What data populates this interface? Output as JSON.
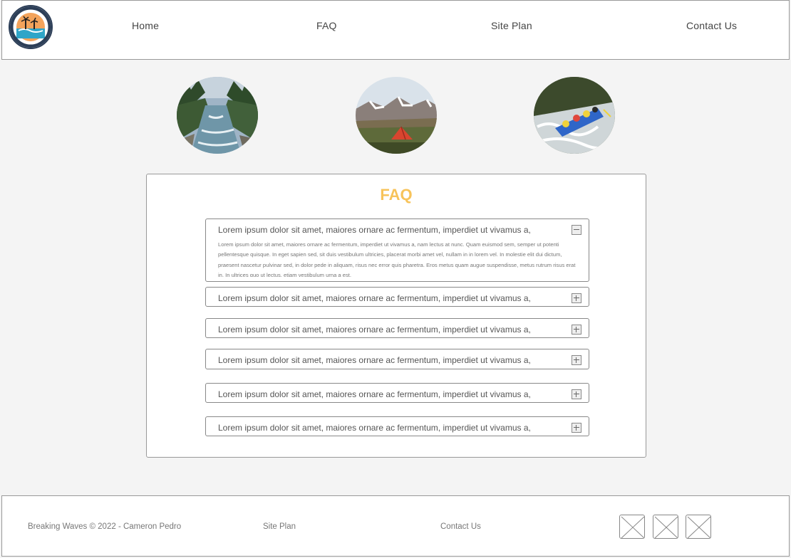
{
  "header": {
    "logo_alt": "Breaking Waves White Water Rafting",
    "nav": [
      {
        "label": "Home"
      },
      {
        "label": "FAQ"
      },
      {
        "label": "Site Plan"
      },
      {
        "label": "Contact Us"
      }
    ]
  },
  "hero": [
    {
      "alt": "river",
      "icon": "river-photo"
    },
    {
      "alt": "camping",
      "icon": "mountain-tent-photo"
    },
    {
      "alt": "rafting",
      "icon": "rafting-photo"
    }
  ],
  "faq": {
    "title": "FAQ",
    "items": [
      {
        "question": "Lorem ipsum dolor sit amet, maiores ornare ac fermentum, imperdiet ut vivamus a,",
        "expanded": true,
        "answer": "Lorem ipsum dolor sit amet, maiores ornare ac fermentum, imperdiet ut vivamus a, nam lectus at nunc. Quam euismod sem, semper ut potenti pellentesque quisque. In eget sapien sed, sit duis vestibulum ultricies, placerat morbi amet vel, nullam in in lorem vel. In molestie elit dui dictum, praesent nascetur pulvinar sed, in dolor pede in aliquam, risus nec error quis pharetra. Eros metus quam augue suspendisse, metus rutrum risus erat in.  In ultrices quo ut lectus, etiam vestibulum urna a est,"
      },
      {
        "question": "Lorem ipsum dolor sit amet, maiores ornare ac fermentum, imperdiet ut vivamus a,",
        "expanded": false
      },
      {
        "question": "Lorem ipsum dolor sit amet, maiores ornare ac fermentum, imperdiet ut vivamus a,",
        "expanded": false
      },
      {
        "question": "Lorem ipsum dolor sit amet, maiores ornare ac fermentum, imperdiet ut vivamus a,",
        "expanded": false
      },
      {
        "question": "Lorem ipsum dolor sit amet, maiores ornare ac fermentum, imperdiet ut vivamus a,",
        "expanded": false
      },
      {
        "question": "Lorem ipsum dolor sit amet, maiores ornare ac fermentum, imperdiet ut vivamus a,",
        "expanded": false
      }
    ]
  },
  "footer": {
    "copyright": "Breaking Waves © 2022 - Cameron Pedro",
    "site_plan": "Site Plan",
    "contact_us": "Contact Us",
    "social": [
      {
        "icon": "image-placeholder-icon"
      },
      {
        "icon": "image-placeholder-icon"
      },
      {
        "icon": "image-placeholder-icon"
      }
    ]
  },
  "colors": {
    "accent": "#f7c35a",
    "background": "#f4f4f4",
    "border": "#999999"
  }
}
